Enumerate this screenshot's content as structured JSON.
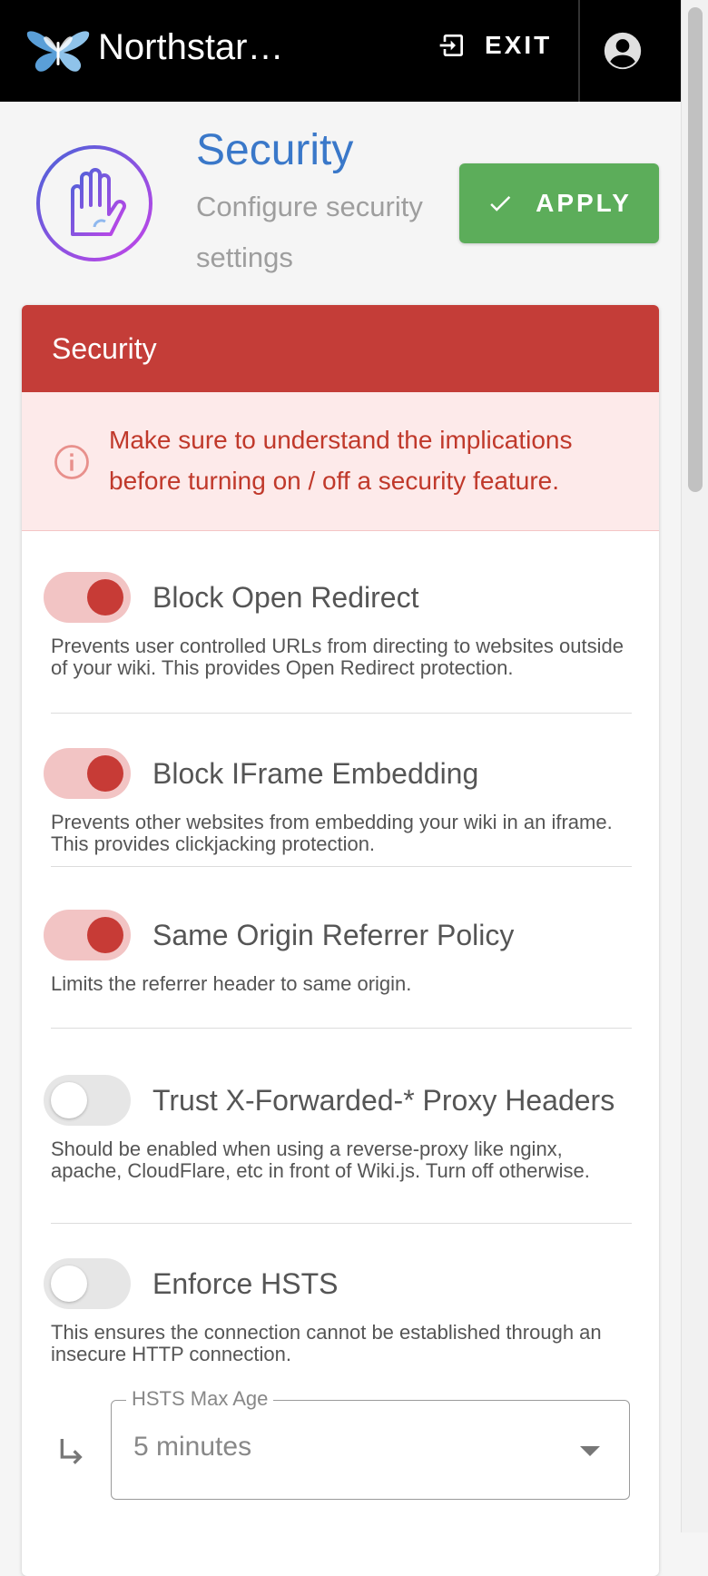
{
  "topbar": {
    "title": "Northstar…",
    "exit_label": "EXIT"
  },
  "header": {
    "title": "Security",
    "subtitle": "Configure security settings",
    "apply_label": "APPLY"
  },
  "card": {
    "title": "Security",
    "alert": "Make sure to understand the implications before turning on / off a security feature."
  },
  "settings": [
    {
      "label": "Block Open Redirect",
      "description": "Prevents user controlled URLs from directing to websites outside of your wiki. This provides Open Redirect protection.",
      "enabled": true
    },
    {
      "label": "Block IFrame Embedding",
      "description": "Prevents other websites from embedding your wiki in an iframe. This provides clickjacking protection.",
      "enabled": true
    },
    {
      "label": "Same Origin Referrer Policy",
      "description": "Limits the referrer header to same origin.",
      "enabled": true
    },
    {
      "label": "Trust X-Forwarded-* Proxy Headers",
      "description": "Should be enabled when using a reverse-proxy like nginx, apache, CloudFlare, etc in front of Wiki.js. Turn off otherwise.",
      "enabled": false
    },
    {
      "label": "Enforce HSTS",
      "description": "This ensures the connection cannot be established through an insecure HTTP connection.",
      "enabled": false
    }
  ],
  "hsts": {
    "legend": "HSTS Max Age",
    "value": "5 minutes"
  },
  "colors": {
    "topbar": "#000000",
    "accent_blue": "#3a78c9",
    "apply_green": "#5cad5a",
    "card_red": "#c43d38",
    "alert_bg": "#fdeaea",
    "toggle_on_knob": "#c73b36"
  },
  "icons": [
    "butterfly-logo-icon",
    "exit-icon",
    "account-circle-icon",
    "hand-shield-icon",
    "check-icon",
    "info-circle-icon",
    "subdirectory-arrow-icon",
    "dropdown-caret-icon"
  ]
}
